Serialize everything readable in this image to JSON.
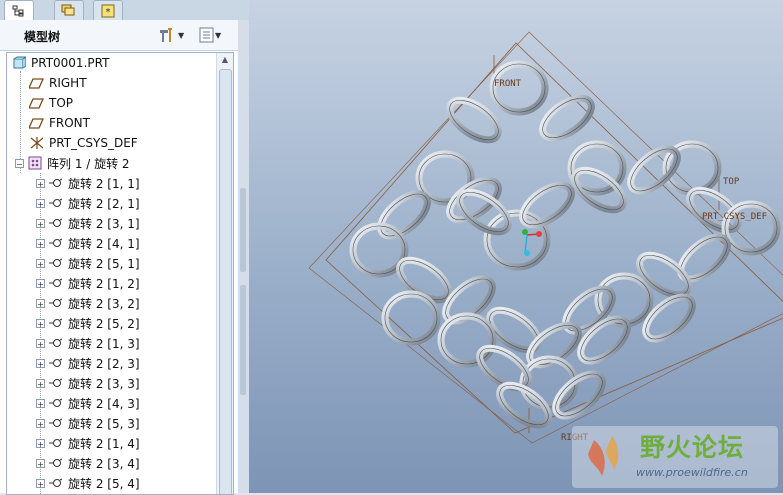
{
  "tabs": [
    {
      "icon": "tree-icon"
    },
    {
      "icon": "layers-icon"
    },
    {
      "icon": "favorites-icon"
    }
  ],
  "panel": {
    "title": "模型树",
    "settings_icon": "tools-icon",
    "show_icon": "list-icon"
  },
  "tree": {
    "root": "PRT0001.PRT",
    "items": [
      {
        "label": "RIGHT",
        "icon": "datum-plane-icon"
      },
      {
        "label": "TOP",
        "icon": "datum-plane-icon"
      },
      {
        "label": "FRONT",
        "icon": "datum-plane-icon"
      },
      {
        "label": "PRT_CSYS_DEF",
        "icon": "csys-icon"
      },
      {
        "label": "阵列 1 / 旋转 2",
        "icon": "pattern-icon"
      }
    ],
    "pattern_children": [
      "旋转 2 [1, 1]",
      "旋转 2 [2, 1]",
      "旋转 2 [3, 1]",
      "旋转 2 [4, 1]",
      "旋转 2 [5, 1]",
      "旋转 2 [1, 2]",
      "旋转 2 [3, 2]",
      "旋转 2 [5, 2]",
      "旋转 2 [1, 3]",
      "旋转 2 [2, 3]",
      "旋转 2 [3, 3]",
      "旋转 2 [4, 3]",
      "旋转 2 [5, 3]",
      "旋转 2 [1, 4]",
      "旋转 2 [3, 4]",
      "旋转 2 [5, 4]"
    ]
  },
  "viewport": {
    "labels": {
      "front": "FRONT",
      "top": "TOP",
      "csys": "PRT_CSYS_DEF",
      "right": "RIGHT"
    }
  },
  "watermark": {
    "title": "野火论坛",
    "url": "www.proewildfire.cn"
  }
}
